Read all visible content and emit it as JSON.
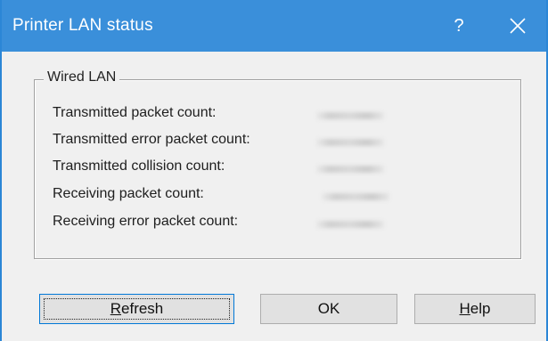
{
  "window": {
    "title": "Printer LAN status",
    "help_glyph": "?",
    "close_icon": "close-icon",
    "titlebar_color": "#3a8fda"
  },
  "group": {
    "label": "Wired LAN",
    "rows": [
      {
        "label": "Transmitted packet count:"
      },
      {
        "label": "Transmitted error packet count:"
      },
      {
        "label": "Transmitted collision count:"
      },
      {
        "label": "Receiving packet count:"
      },
      {
        "label": "Receiving error packet count:"
      }
    ]
  },
  "buttons": {
    "refresh": {
      "mnemonic": "R",
      "rest": "efresh"
    },
    "ok": "OK",
    "help": {
      "mnemonic": "H",
      "rest": "elp"
    }
  }
}
